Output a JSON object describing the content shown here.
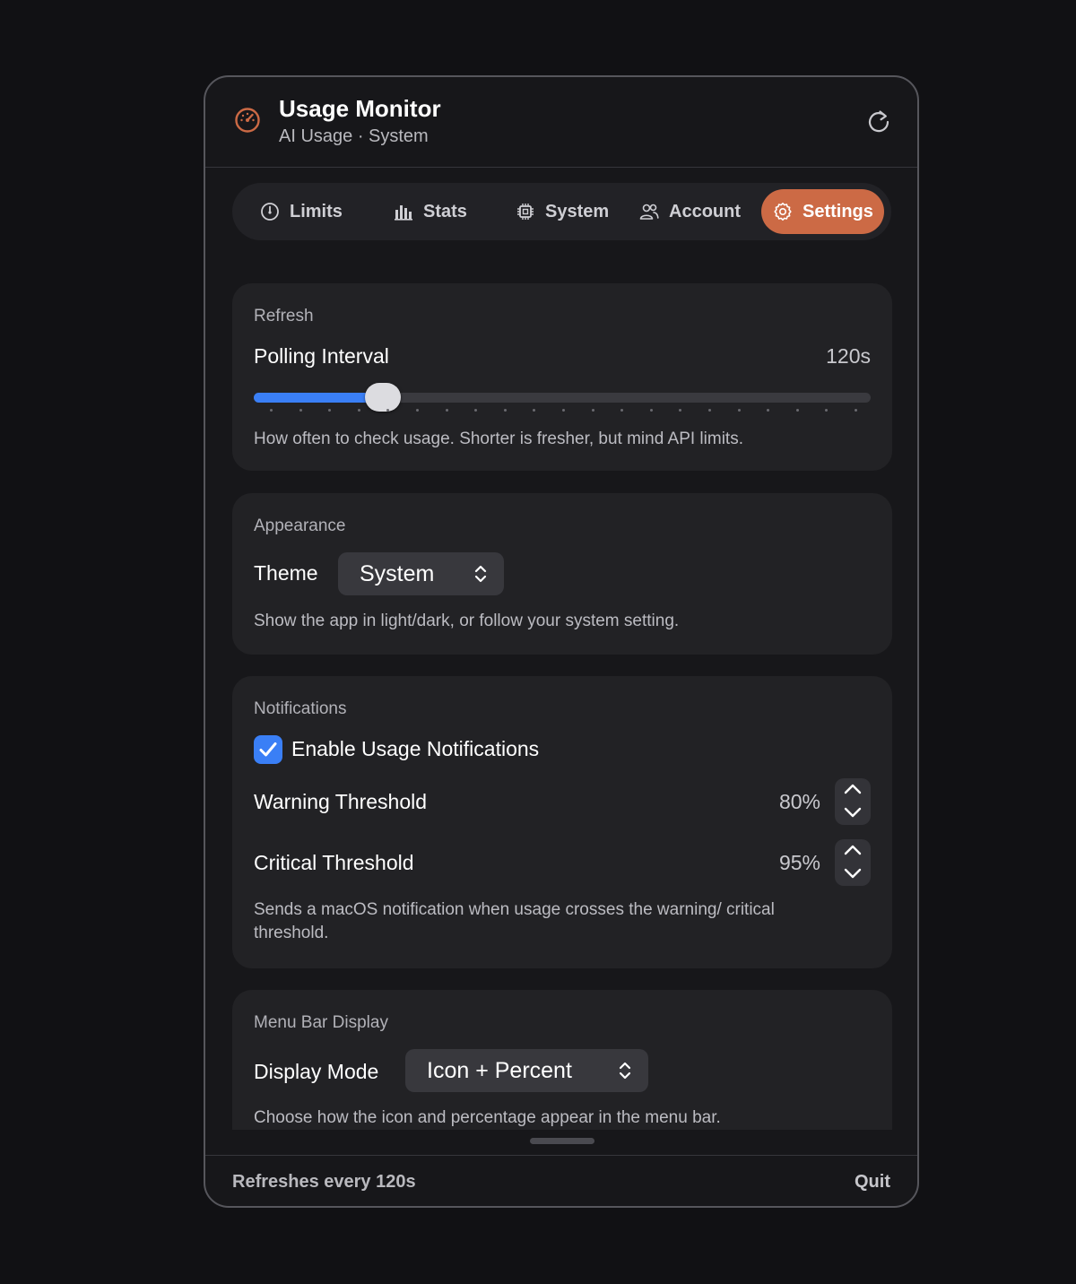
{
  "header": {
    "title": "Usage Monitor",
    "subtitle": "AI Usage · System",
    "app_icon": "speedometer-icon",
    "refresh_icon": "refresh-icon"
  },
  "tabs": [
    {
      "label": "Limits",
      "icon": "gauge-icon",
      "active": false
    },
    {
      "label": "Stats",
      "icon": "bar-chart-icon",
      "active": false
    },
    {
      "label": "System",
      "icon": "cpu-icon",
      "active": false
    },
    {
      "label": "Account",
      "icon": "people-icon",
      "active": false
    },
    {
      "label": "Settings",
      "icon": "gear-icon",
      "active": true
    }
  ],
  "refresh_section": {
    "label": "Refresh",
    "polling_label": "Polling Interval",
    "polling_value": "120s",
    "slider_fraction": 0.18,
    "help": "How often to check usage. Shorter is fresher, but mind API limits."
  },
  "appearance_section": {
    "label": "Appearance",
    "theme_label": "Theme",
    "theme_value": "System",
    "help": "Show the app in light/dark, or follow your system setting."
  },
  "notifications_section": {
    "label": "Notifications",
    "enable_label": "Enable Usage Notifications",
    "enabled": true,
    "warning_label": "Warning Threshold",
    "warning_value": "80%",
    "critical_label": "Critical Threshold",
    "critical_value": "95%",
    "help": "Sends a macOS notification when usage crosses the warning/ critical threshold."
  },
  "menubar_section": {
    "label": "Menu Bar Display",
    "mode_label": "Display Mode",
    "mode_value": "Icon + Percent",
    "help": "Choose how the icon and percentage appear in the menu bar."
  },
  "footer": {
    "status": "Refreshes every 120s",
    "quit_label": "Quit"
  },
  "colors": {
    "accent": "#cc6a45",
    "slider_blue": "#3a7ff6",
    "background": "#17171a",
    "card": "#222225"
  }
}
